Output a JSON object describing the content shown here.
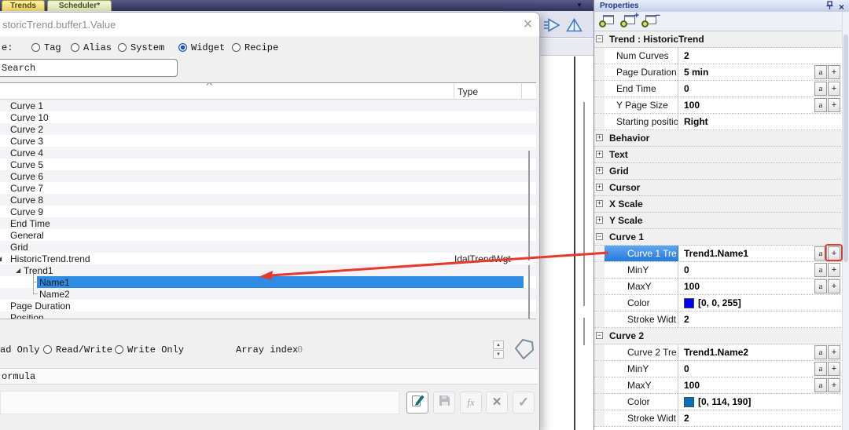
{
  "tab_bar": {
    "tabs": [
      {
        "label": "Trends"
      },
      {
        "label": "Scheduler*"
      }
    ],
    "overflow_glyph": "▼"
  },
  "workspace": {
    "icons": [
      {
        "name": "run"
      },
      {
        "name": "simulate"
      }
    ]
  },
  "properties_panel": {
    "title": "Properties",
    "close_glyph": "×",
    "btn_a": "a",
    "btn_plus": "+",
    "rows": [
      {
        "kind": "group",
        "exp": "−",
        "label": "Trend : HistoricTrend"
      },
      {
        "kind": "prop",
        "label": "Num Curves",
        "value": "2"
      },
      {
        "kind": "prop",
        "label": "Page Duration",
        "value": "5 min"
      },
      {
        "kind": "prop",
        "label": "End Time",
        "value": "0"
      },
      {
        "kind": "prop",
        "label": "Y Page Size",
        "value": "100"
      },
      {
        "kind": "prop",
        "label": "Starting positio",
        "value": "Right"
      },
      {
        "kind": "cat",
        "exp": "+",
        "label": "Behavior"
      },
      {
        "kind": "cat",
        "exp": "+",
        "label": "Text"
      },
      {
        "kind": "cat",
        "exp": "+",
        "label": "Grid"
      },
      {
        "kind": "cat",
        "exp": "+",
        "label": "Cursor"
      },
      {
        "kind": "cat",
        "exp": "+",
        "label": "X Scale"
      },
      {
        "kind": "cat",
        "exp": "+",
        "label": "Y Scale"
      },
      {
        "kind": "cat",
        "exp": "−",
        "label": "Curve 1"
      },
      {
        "kind": "prop",
        "label": "Curve 1 Tre",
        "value": "Trend1.Name1",
        "selected": true
      },
      {
        "kind": "prop",
        "label": "MinY",
        "value": "0"
      },
      {
        "kind": "prop",
        "label": "MaxY",
        "value": "100"
      },
      {
        "kind": "prop",
        "label": "Color",
        "value": "[0, 0, 255]",
        "swatch": "#0000ff"
      },
      {
        "kind": "prop",
        "label": "Stroke Widt",
        "value": "2"
      },
      {
        "kind": "cat",
        "exp": "−",
        "label": "Curve 2"
      },
      {
        "kind": "prop",
        "label": "Curve 2 Tre",
        "value": "Trend1.Name2"
      },
      {
        "kind": "prop",
        "label": "MinY",
        "value": "0"
      },
      {
        "kind": "prop",
        "label": "MaxY",
        "value": "100"
      },
      {
        "kind": "prop",
        "label": "Color",
        "value": "[0, 114, 190]",
        "swatch": "#0072be"
      },
      {
        "kind": "prop",
        "label": "Stroke Widt",
        "value": "2"
      }
    ]
  },
  "dialog": {
    "title": "storicTrend.buffer1.Value",
    "close_glyph": "×",
    "source_label": "e:",
    "source_options": [
      {
        "label": "Tag"
      },
      {
        "label": "Alias"
      },
      {
        "label": "System"
      },
      {
        "label": "Widget",
        "selected": true
      },
      {
        "label": "Recipe"
      }
    ],
    "search": {
      "value": "Search"
    },
    "list": {
      "sort_indicator": "^",
      "type_header": "Type",
      "expander_glyph": "◢",
      "selection_color": "#2f8ce4",
      "items": [
        {
          "label": "Curve 1"
        },
        {
          "label": "Curve 10"
        },
        {
          "label": "Curve 2"
        },
        {
          "label": "Curve 3"
        },
        {
          "label": "Curve 4"
        },
        {
          "label": "Curve 5"
        },
        {
          "label": "Curve 6"
        },
        {
          "label": "Curve 7"
        },
        {
          "label": "Curve 8"
        },
        {
          "label": "Curve 9"
        },
        {
          "label": "End Time"
        },
        {
          "label": "General"
        },
        {
          "label": "Grid"
        },
        {
          "label": "HistoricTrend.trend",
          "type": "IdalTrendWgt"
        },
        {
          "label": "Trend1"
        },
        {
          "label": "Name1",
          "selected": true
        },
        {
          "label": "Name2"
        },
        {
          "label": "Page Duration"
        },
        {
          "label": "Position"
        }
      ]
    },
    "access_options": [
      {
        "label": "ad Only"
      },
      {
        "label": "Read/Write"
      },
      {
        "label": "Write Only"
      }
    ],
    "array_index": {
      "label": "Array index",
      "value": "0"
    },
    "formula_label": "ormula",
    "actions": {
      "fx_glyph": "fx",
      "delete_glyph": "×",
      "apply_glyph": "✓"
    }
  },
  "annotations": {
    "arrow_color": "#e6392b"
  }
}
